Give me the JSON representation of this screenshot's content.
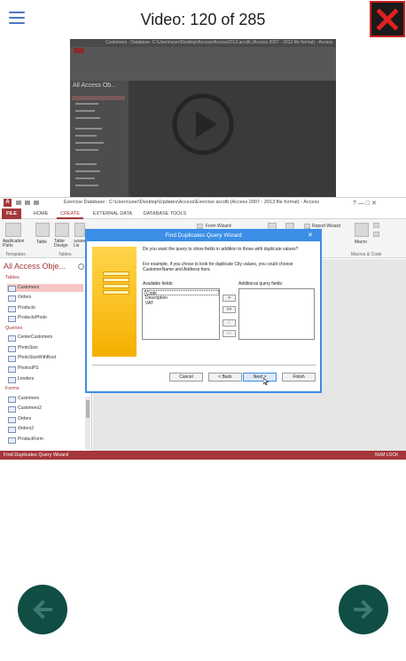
{
  "header": {
    "title": "Video: 120 of 285"
  },
  "thumbnail": {
    "window_title": "Customers : Database- C:\\Users\\user\\Desktop\\Access\\Access2013.accdb (Access 2007 - 2013 file format) - Access",
    "nav_heading": "All Access Ob..."
  },
  "app": {
    "window_title": "Exercise Database : C:\\Users\\user\\Desktop\\Updates\\Access\\Exercise accdb (Access 2007 - 2013 file format) - Access",
    "window_controls": "? — □ ✕",
    "tabs": [
      {
        "label": "FILE"
      },
      {
        "label": "HOME"
      },
      {
        "label": "CREATE"
      },
      {
        "label": "EXTERNAL DATA"
      },
      {
        "label": "DATABASE TOOLS"
      }
    ],
    "ribbon": {
      "items": {
        "application_parts": "Application Parts",
        "table": "Table",
        "table_design": "Table Design",
        "sharepoint_lists": "Share Lis",
        "form_wizard": "Form Wizard",
        "report_wizard": "Report Wizard",
        "macro": "Macro"
      },
      "groups": {
        "templates": "Templates",
        "tables": "Tables",
        "macros_code": "Macros & Code"
      }
    },
    "nav": {
      "heading": "All Access Obje...",
      "sections": [
        {
          "label": "Tables",
          "items": [
            "Customers",
            "Orders",
            "Products",
            "ProductsPhoto"
          ]
        },
        {
          "label": "Queries",
          "items": [
            "CenterCustomers",
            "PhotoSize",
            "PhotoSizeWithBoot",
            "PhotosIPS",
            "Londers"
          ]
        },
        {
          "label": "Forms",
          "items": [
            "Customers",
            "Customers2",
            "Orders",
            "Orders2",
            "ProductForm"
          ]
        }
      ],
      "selected": "Customers"
    },
    "status": {
      "left": "Find Duplicates Query Wizard",
      "right": "NUM LOCK"
    }
  },
  "dialog": {
    "title": "Find Duplicates Query Wizard",
    "intro": "Do you want the query to show fields in addition to those with duplicate values?",
    "example": "For example, if you chose to look for duplicate City values, you could choose CustomerName and Address here.",
    "available_label": "Available fields:",
    "additional_label": "Additional query fields:",
    "available_fields": [
      "Code",
      "Description",
      "VAT"
    ],
    "move_buttons": [
      ">",
      ">>",
      "<",
      "<<"
    ],
    "buttons": {
      "cancel": "Cancel",
      "back": "< Back",
      "next": "Next >",
      "finish": "Finish"
    }
  },
  "footer": {
    "prev_icon": "arrow-left-icon",
    "next_icon": "arrow-right-icon"
  },
  "colors": {
    "access_red": "#a4373a",
    "dialog_blue": "#3a8ee6",
    "nav_teal": "#0f4d45",
    "close_red": "#d01f1f"
  }
}
